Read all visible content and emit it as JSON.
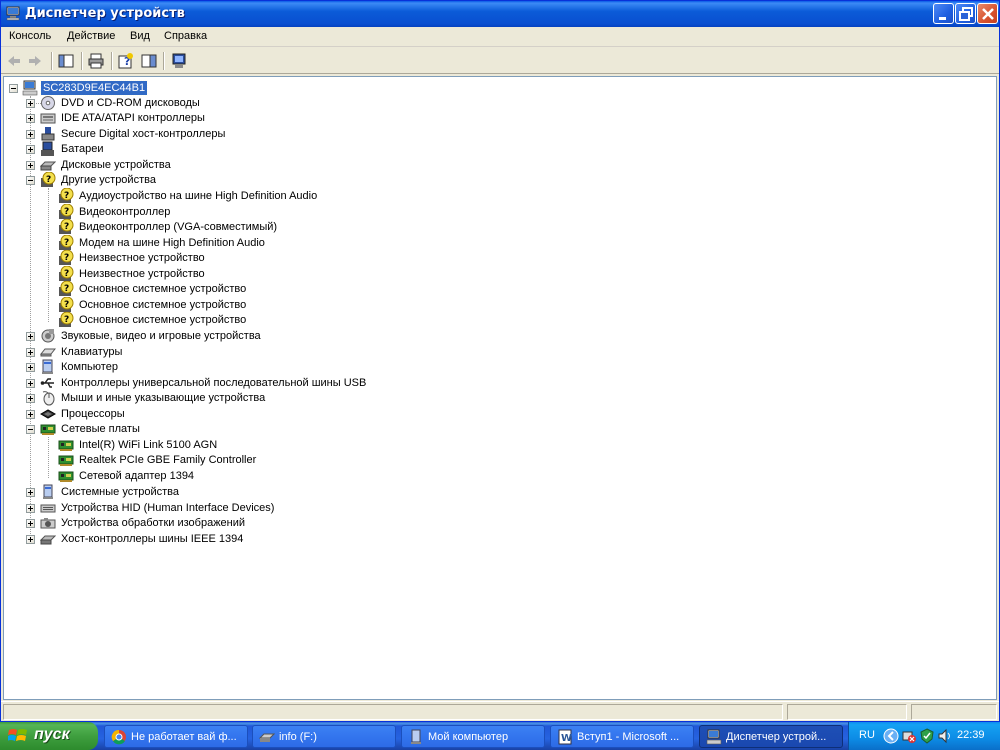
{
  "window": {
    "title": "Диспетчер устройств",
    "icon": "computer-icon"
  },
  "menubar": {
    "items": [
      "Консоль",
      "Действие",
      "Вид",
      "Справка"
    ]
  },
  "toolbar": {
    "buttons": [
      "back-arrow-icon",
      "forward-arrow-icon",
      "show-hide-tree-icon",
      "print-icon",
      "help-properties-icon",
      "console-tree-icon",
      "scan-hardware-icon"
    ]
  },
  "tree": {
    "root": "SC283D9E4EC44B1",
    "items": [
      {
        "label": "DVD и CD-ROM дисководы",
        "icon": "cdrom-icon",
        "expanded": false
      },
      {
        "label": "IDE ATA/ATAPI контроллеры",
        "icon": "ide-controller-icon",
        "expanded": false
      },
      {
        "label": "Secure Digital хост-контроллеры",
        "icon": "sd-controller-icon",
        "expanded": false
      },
      {
        "label": "Батареи",
        "icon": "battery-icon",
        "expanded": false
      },
      {
        "label": "Дисковые устройства",
        "icon": "disk-drive-icon",
        "expanded": false
      },
      {
        "label": "Другие устройства",
        "icon": "unknown-device-icon",
        "expanded": true,
        "children": [
          "Аудиоустройство на шине High Definition Audio",
          "Видеоконтроллер",
          "Видеоконтроллер (VGA-совместимый)",
          "Модем на шине High Definition Audio",
          "Неизвестное устройство",
          "Неизвестное устройство",
          "Основное системное устройство",
          "Основное системное устройство",
          "Основное системное устройство"
        ]
      },
      {
        "label": "Звуковые, видео и игровые устройства",
        "icon": "sound-icon",
        "expanded": false
      },
      {
        "label": "Клавиатуры",
        "icon": "keyboard-icon",
        "expanded": false
      },
      {
        "label": "Компьютер",
        "icon": "computer-icon",
        "expanded": false
      },
      {
        "label": "Контроллеры универсальной последовательной шины USB",
        "icon": "usb-icon",
        "expanded": false
      },
      {
        "label": "Мыши и иные указывающие устройства",
        "icon": "mouse-icon",
        "expanded": false
      },
      {
        "label": "Процессоры",
        "icon": "processor-icon",
        "expanded": false
      },
      {
        "label": "Сетевые платы",
        "icon": "network-card-icon",
        "expanded": true,
        "children": [
          "Intel(R) WiFi Link 5100 AGN",
          "Realtek PCIe GBE Family Controller",
          "Сетевой адаптер 1394"
        ]
      },
      {
        "label": "Системные устройства",
        "icon": "system-device-icon",
        "expanded": false
      },
      {
        "label": "Устройства HID (Human Interface Devices)",
        "icon": "hid-icon",
        "expanded": false
      },
      {
        "label": "Устройства обработки изображений",
        "icon": "imaging-icon",
        "expanded": false
      },
      {
        "label": "Хост-контроллеры шины IEEE 1394",
        "icon": "ieee1394-icon",
        "expanded": false
      }
    ]
  },
  "taskbar": {
    "start_label": "пуск",
    "tasks": [
      {
        "label": "Не работает вай ф...",
        "icon": "chrome-icon",
        "active": false
      },
      {
        "label": "info (F:)",
        "icon": "drive-icon",
        "active": false
      },
      {
        "label": "Мой компьютер",
        "icon": "my-computer-icon",
        "active": false
      },
      {
        "label": "Вступ1 - Microsoft ...",
        "icon": "word-icon",
        "active": false
      },
      {
        "label": "Диспетчер устрой...",
        "icon": "device-manager-icon",
        "active": true
      }
    ],
    "language": "RU",
    "clock": "22:39"
  },
  "colors": {
    "titlebar": "#0a4fd0",
    "selection": "#316ac5",
    "taskbar": "#2663e0",
    "start": "#3f9f3f",
    "tray": "#0d8be5"
  }
}
